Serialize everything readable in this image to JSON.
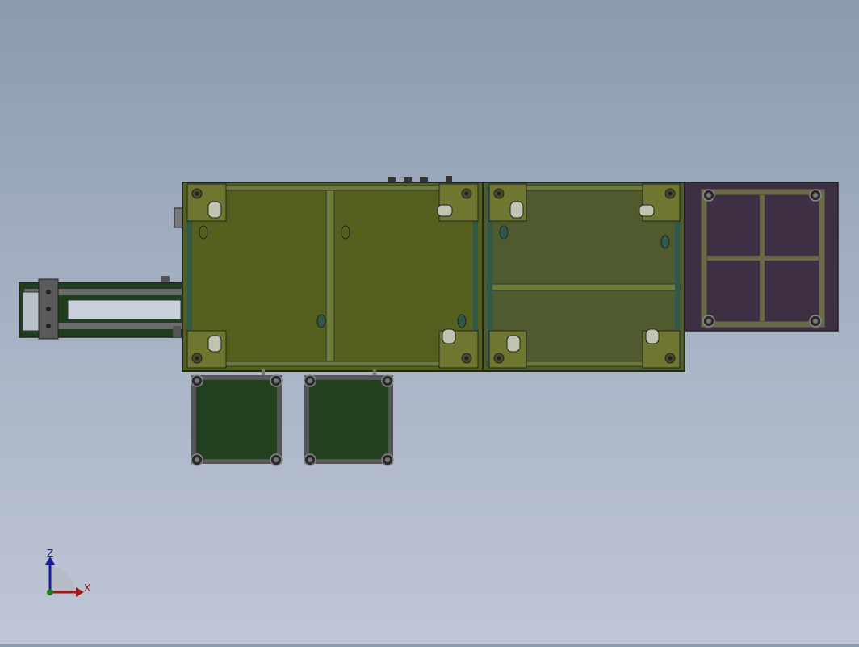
{
  "app": {
    "title": ""
  },
  "triad": {
    "z_label": "Z",
    "x_label": "X"
  },
  "colors": {
    "background_top": "#8a9bb0",
    "background_bottom": "#bfc6d6",
    "main_panel": "#55601e",
    "right_panel": "#4f5a2e",
    "purple_panel": "#3f2f45",
    "green_box": "#22401f",
    "frame_gray": "#6e6e6e",
    "axis_z": "#1a1aa0",
    "axis_x": "#a01a1a"
  },
  "icons": [
    "coordinate-triad-icon"
  ]
}
